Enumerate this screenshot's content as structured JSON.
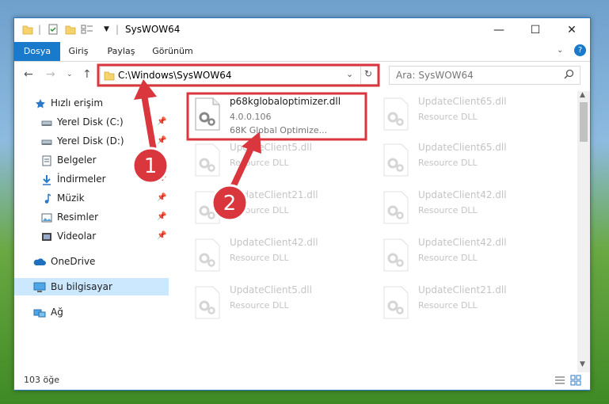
{
  "window": {
    "title": "SysWOW64"
  },
  "ribbon": {
    "tabs": [
      {
        "label": "Dosya"
      },
      {
        "label": "Giriş"
      },
      {
        "label": "Paylaş"
      },
      {
        "label": "Görünüm"
      }
    ]
  },
  "address": {
    "path": "C:\\Windows\\SysWOW64"
  },
  "search": {
    "placeholder": "Ara: SysWOW64"
  },
  "sidebar": {
    "items": [
      {
        "label": "Hızlı erişim"
      },
      {
        "label": "Yerel Disk (C:)"
      },
      {
        "label": "Yerel Disk (D:)"
      },
      {
        "label": "Belgeler"
      },
      {
        "label": "İndirmeler"
      },
      {
        "label": "Müzik"
      },
      {
        "label": "Resimler"
      },
      {
        "label": "Videolar"
      },
      {
        "label": "OneDrive"
      },
      {
        "label": "Bu bilgisayar"
      },
      {
        "label": "Ağ"
      }
    ]
  },
  "files": [
    {
      "name": "p68kglobaloptimizer.dll",
      "line2": "4.0.0.106",
      "line3": "68K Global Optimize..."
    },
    {
      "name": "UpdateClient65.dll",
      "line2": "Resource DLL"
    },
    {
      "name": "UpdateClient5.dll",
      "line2": "Resource DLL"
    },
    {
      "name": "UpdateClient65.dll",
      "line2": "Resource DLL"
    },
    {
      "name": "UpdateClient21.dll",
      "line2": "Resource DLL"
    },
    {
      "name": "UpdateClient42.dll",
      "line2": "Resource DLL"
    },
    {
      "name": "UpdateClient42.dll",
      "line2": "Resource DLL"
    },
    {
      "name": "UpdateClient42.dll",
      "line2": "Resource DLL"
    },
    {
      "name": "UpdateClient5.dll",
      "line2": "Resource DLL"
    },
    {
      "name": "UpdateClient21.dll",
      "line2": "Resource DLL"
    }
  ],
  "status": {
    "count": "103 öğe"
  },
  "annotations": {
    "step1": "1",
    "step2": "2"
  },
  "colors": {
    "accent": "#1979ca",
    "highlight": "#d9363e",
    "selected": "#cce8ff"
  }
}
